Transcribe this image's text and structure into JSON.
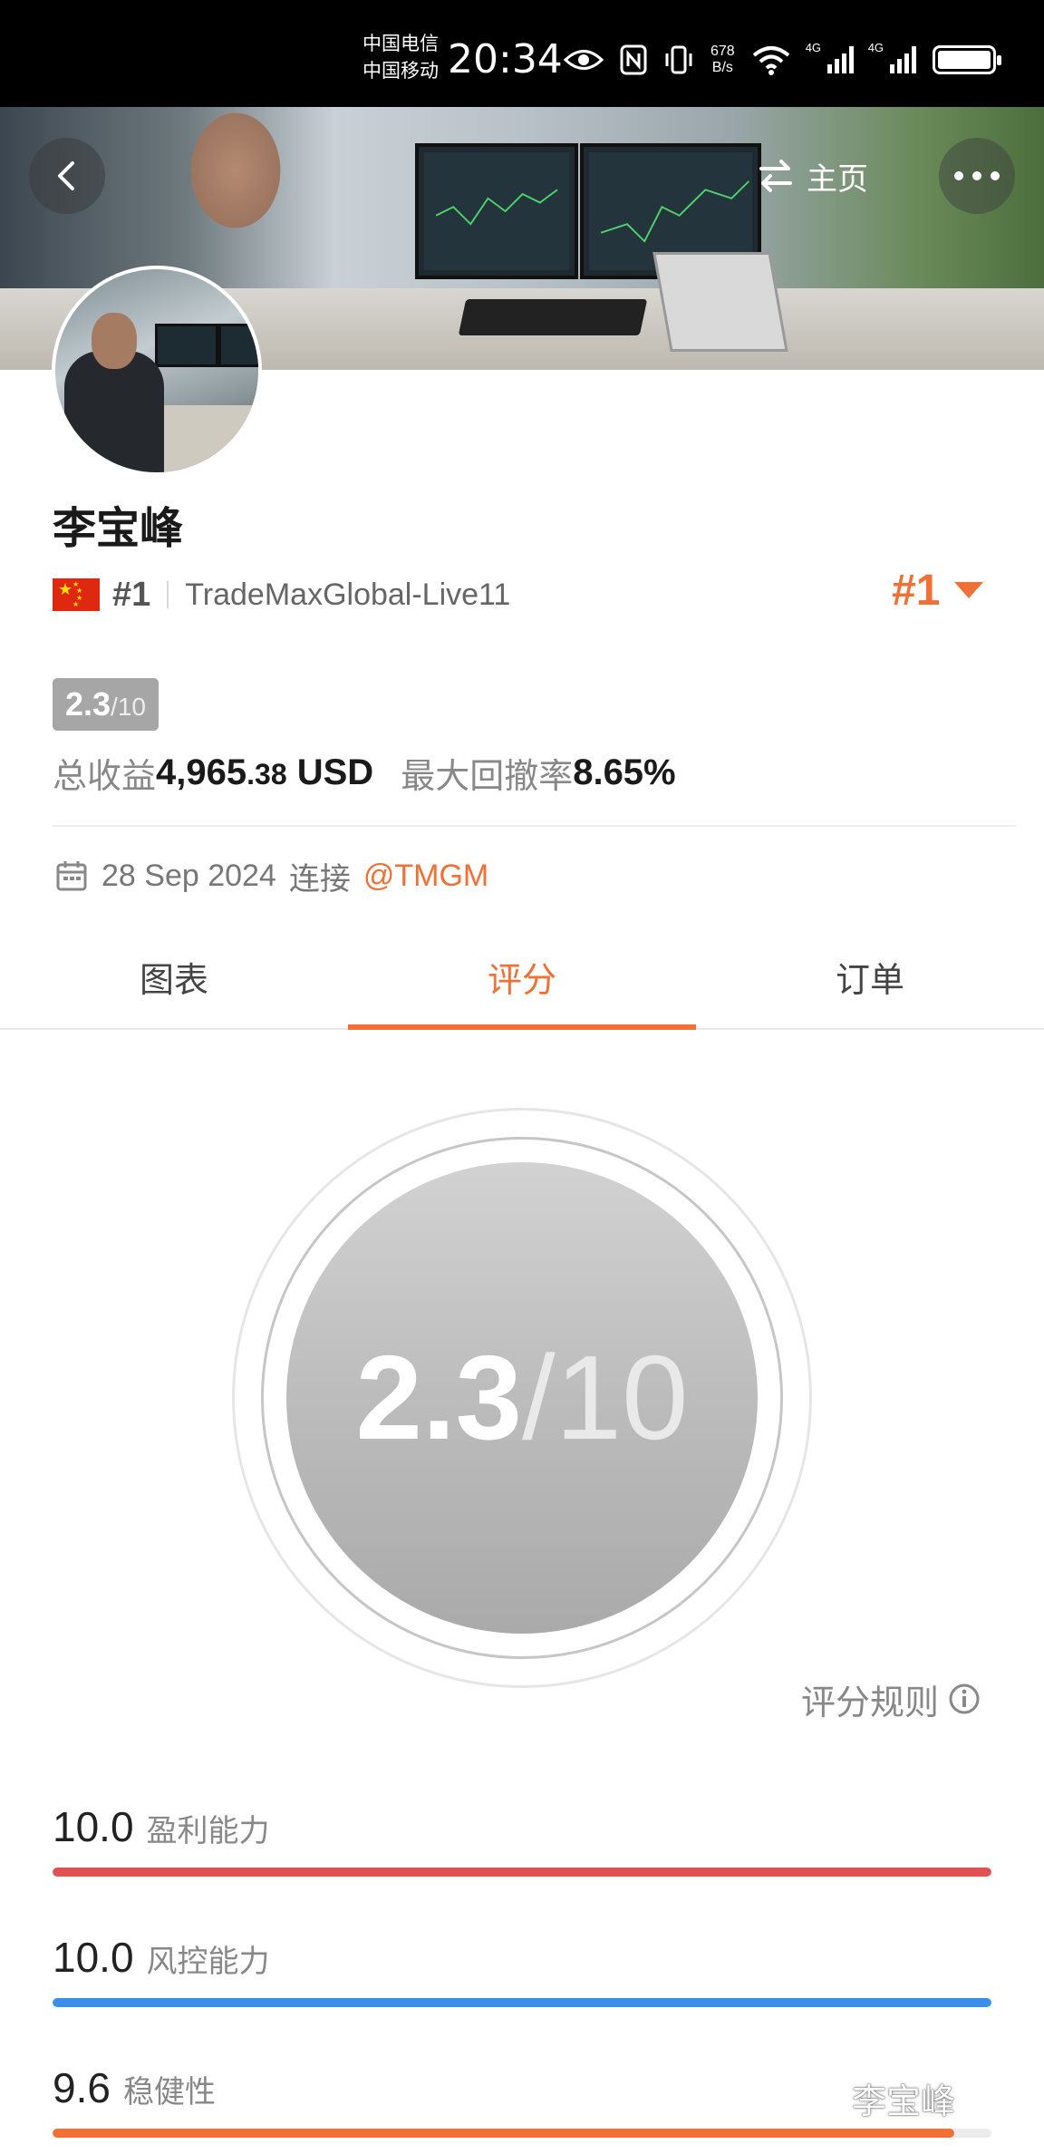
{
  "status_bar": {
    "carrier_1": "中国电信",
    "carrier_2": "中国移动",
    "time": "20:34",
    "net_speed_value": "678",
    "net_speed_unit": "B/s",
    "signal_tag_1": "4G",
    "signal_tag_2": "4G"
  },
  "header": {
    "home_label": "主页",
    "back_icon": "chevron-left-icon",
    "home_icon": "swap-icon",
    "more_icon": "more-dots-icon"
  },
  "profile": {
    "name": "李宝峰",
    "rank_small": "#1",
    "server": "TradeMaxGlobal-Live11",
    "rank_big": "#1",
    "score_value": "2.3",
    "score_denominator": "/10",
    "total_return_label": "总收益",
    "total_return_int": "4,965",
    "total_return_dec": ".38",
    "total_return_unit": "USD",
    "max_drawdown_label": "最大回撤率",
    "max_drawdown_value": "8.65%",
    "connect_date": "28 Sep 2024",
    "connect_label": "连接",
    "broker": "@TMGM"
  },
  "tabs": [
    {
      "label": "图表",
      "active": false
    },
    {
      "label": "评分",
      "active": true
    },
    {
      "label": "订单",
      "active": false
    }
  ],
  "score": {
    "value": "2.3",
    "denominator": "/10",
    "rules_label": "评分规则"
  },
  "metrics": [
    {
      "value": "10.0",
      "label": "盈利能力",
      "fraction": 1.0,
      "color": "#e05252"
    },
    {
      "value": "10.0",
      "label": "风控能力",
      "fraction": 1.0,
      "color": "#3b8fe8"
    },
    {
      "value": "9.6",
      "label": "稳健性",
      "fraction": 0.96,
      "color": "#f07035"
    }
  ],
  "watermark": "李宝峰",
  "colors": {
    "accent": "#f07035",
    "score_gray": "#a6a6a6"
  }
}
